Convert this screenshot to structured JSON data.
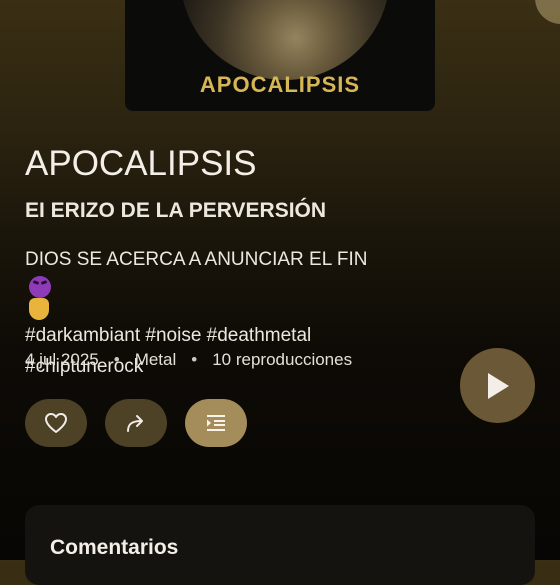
{
  "track": {
    "cover_title": "APOCALIPSIS",
    "title": "APOCALIPSIS",
    "artist": "EI ERIZO DE LA PERVERSIÓN",
    "description_line1": "DIOS SE ACERCA A ANUNCIAR EL FIN",
    "description_emojis": [
      "smiling-devil-emoji",
      "rock-hand-emoji"
    ],
    "description_line2": "#darkambiant #noise #deathmetal",
    "description_line3": "#chiptunerock",
    "date": "4 jul 2025",
    "genre": "Metal",
    "plays": "10 reproducciones",
    "separator": "•"
  },
  "actions": {
    "like_icon": "heart-icon",
    "share_icon": "share-icon",
    "queue_icon": "queue-list-icon",
    "play_icon": "play-icon"
  },
  "comments": {
    "title": "Comentarios"
  },
  "colors": {
    "accent_gold": "#d7b656",
    "pill_bg": "#4d4126",
    "pill_active_bg": "#a48d5a",
    "play_bg": "#6a5836"
  }
}
